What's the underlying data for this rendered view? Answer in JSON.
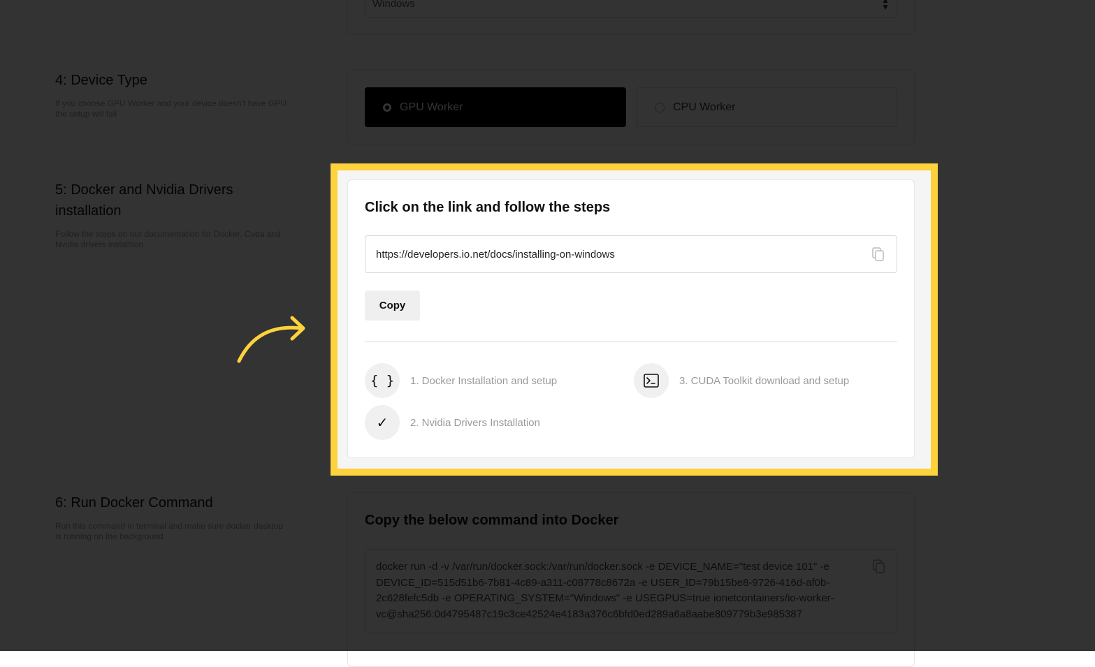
{
  "os_select": {
    "value": "Windows"
  },
  "section4": {
    "title": "4: Device Type",
    "subtitle_line1": "If you choose GPU Worker and your device doesn't have GPU",
    "subtitle_line2": "the setup will fail",
    "options": [
      {
        "label": "GPU Worker",
        "selected": true
      },
      {
        "label": "CPU Worker",
        "selected": false
      }
    ]
  },
  "section5": {
    "title_line1": "5: Docker and Nvidia Drivers",
    "title_line2": "installation",
    "subtitle_line1": "Follow the steps on our documentation for Docker, Cuda and",
    "subtitle_line2": "Nvidia drivers installtion",
    "card_heading": "Click on the link and follow the steps",
    "url": "https://developers.io.net/docs/installing-on-windows",
    "copy_label": "Copy",
    "steps": [
      {
        "label": "1. Docker Installation and setup",
        "icon": "braces-icon",
        "glyph": "{ }"
      },
      {
        "label": "2. Nvidia Drivers Installation",
        "icon": "check-icon",
        "glyph": "✓"
      },
      {
        "label": "3. CUDA Toolkit download and setup",
        "icon": "terminal-icon",
        "glyph": ""
      }
    ]
  },
  "section6": {
    "title": "6: Run Docker Command",
    "subtitle_line1": "Run this command in terminal and make sure docker desktop",
    "subtitle_line2": "is running on the background",
    "card_heading": "Copy the below command into Docker",
    "command_lines": [
      "docker run -d -v /var/run/docker.sock:/var/run/docker.sock -e DEVICE_NAME=\"test device 101\" -e",
      "DEVICE_ID=515d51b6-7b81-4c89-a311-c08778c8672a -e USER_ID=79b15be8-9726-416d-af0b-",
      "2c628fefc5db -e OPERATING_SYSTEM=\"Windows\" -e USEGPUS=true ionetcontainers/io-worker-",
      "vc@sha256:0d4795487c19c3ce42524e4183a376c6bfd0ed289a6a8aabe809779b3e985387"
    ]
  },
  "colors": {
    "highlight": "#fdd23c",
    "dim_overlay": "rgba(0,0,0,0.8)",
    "gpu_selected_bg": "#000000"
  }
}
